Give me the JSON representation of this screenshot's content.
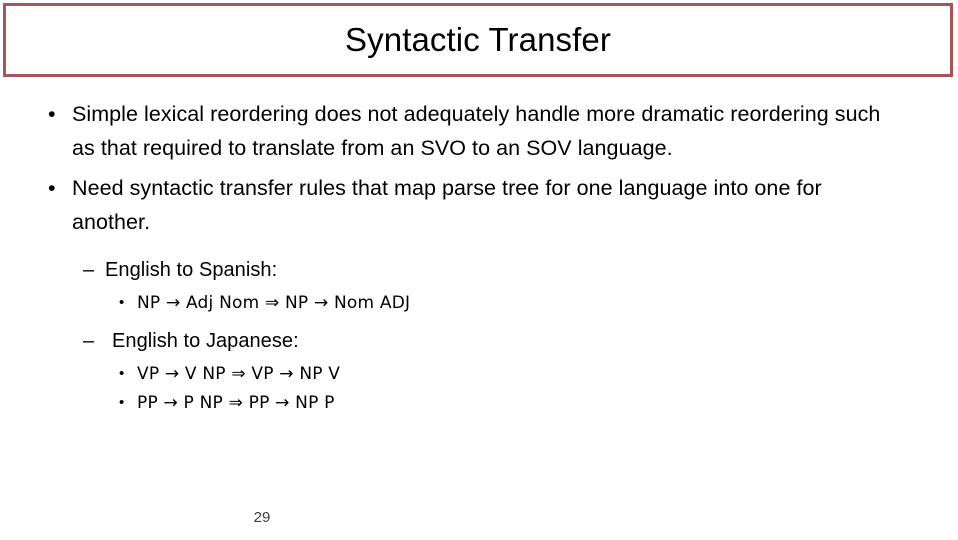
{
  "slide": {
    "title": "Syntactic Transfer",
    "page_number": "29",
    "accent_color": "#a65657",
    "background_color": "#ffffff",
    "text_color": "#000000"
  },
  "bullets": {
    "level1": [
      {
        "marker": "•",
        "text": "Simple lexical reordering does not adequately handle more dramatic reordering such as that required to translate from an SVO to an SOV language."
      },
      {
        "marker": "•",
        "text": "Need syntactic transfer rules that map parse tree for one language into one for another."
      }
    ],
    "level2": [
      {
        "marker": "–",
        "text": "English to Spanish:"
      },
      {
        "marker": "–",
        "text": "English to Japanese:"
      }
    ],
    "level3": [
      {
        "marker": "•",
        "text": "NP → Adj Nom  ⇒  NP → Nom ADJ"
      },
      {
        "marker": "•",
        "text": "VP → V NP  ⇒  VP → NP V"
      },
      {
        "marker": "•",
        "text": "PP → P NP  ⇒  PP → NP P"
      }
    ]
  }
}
